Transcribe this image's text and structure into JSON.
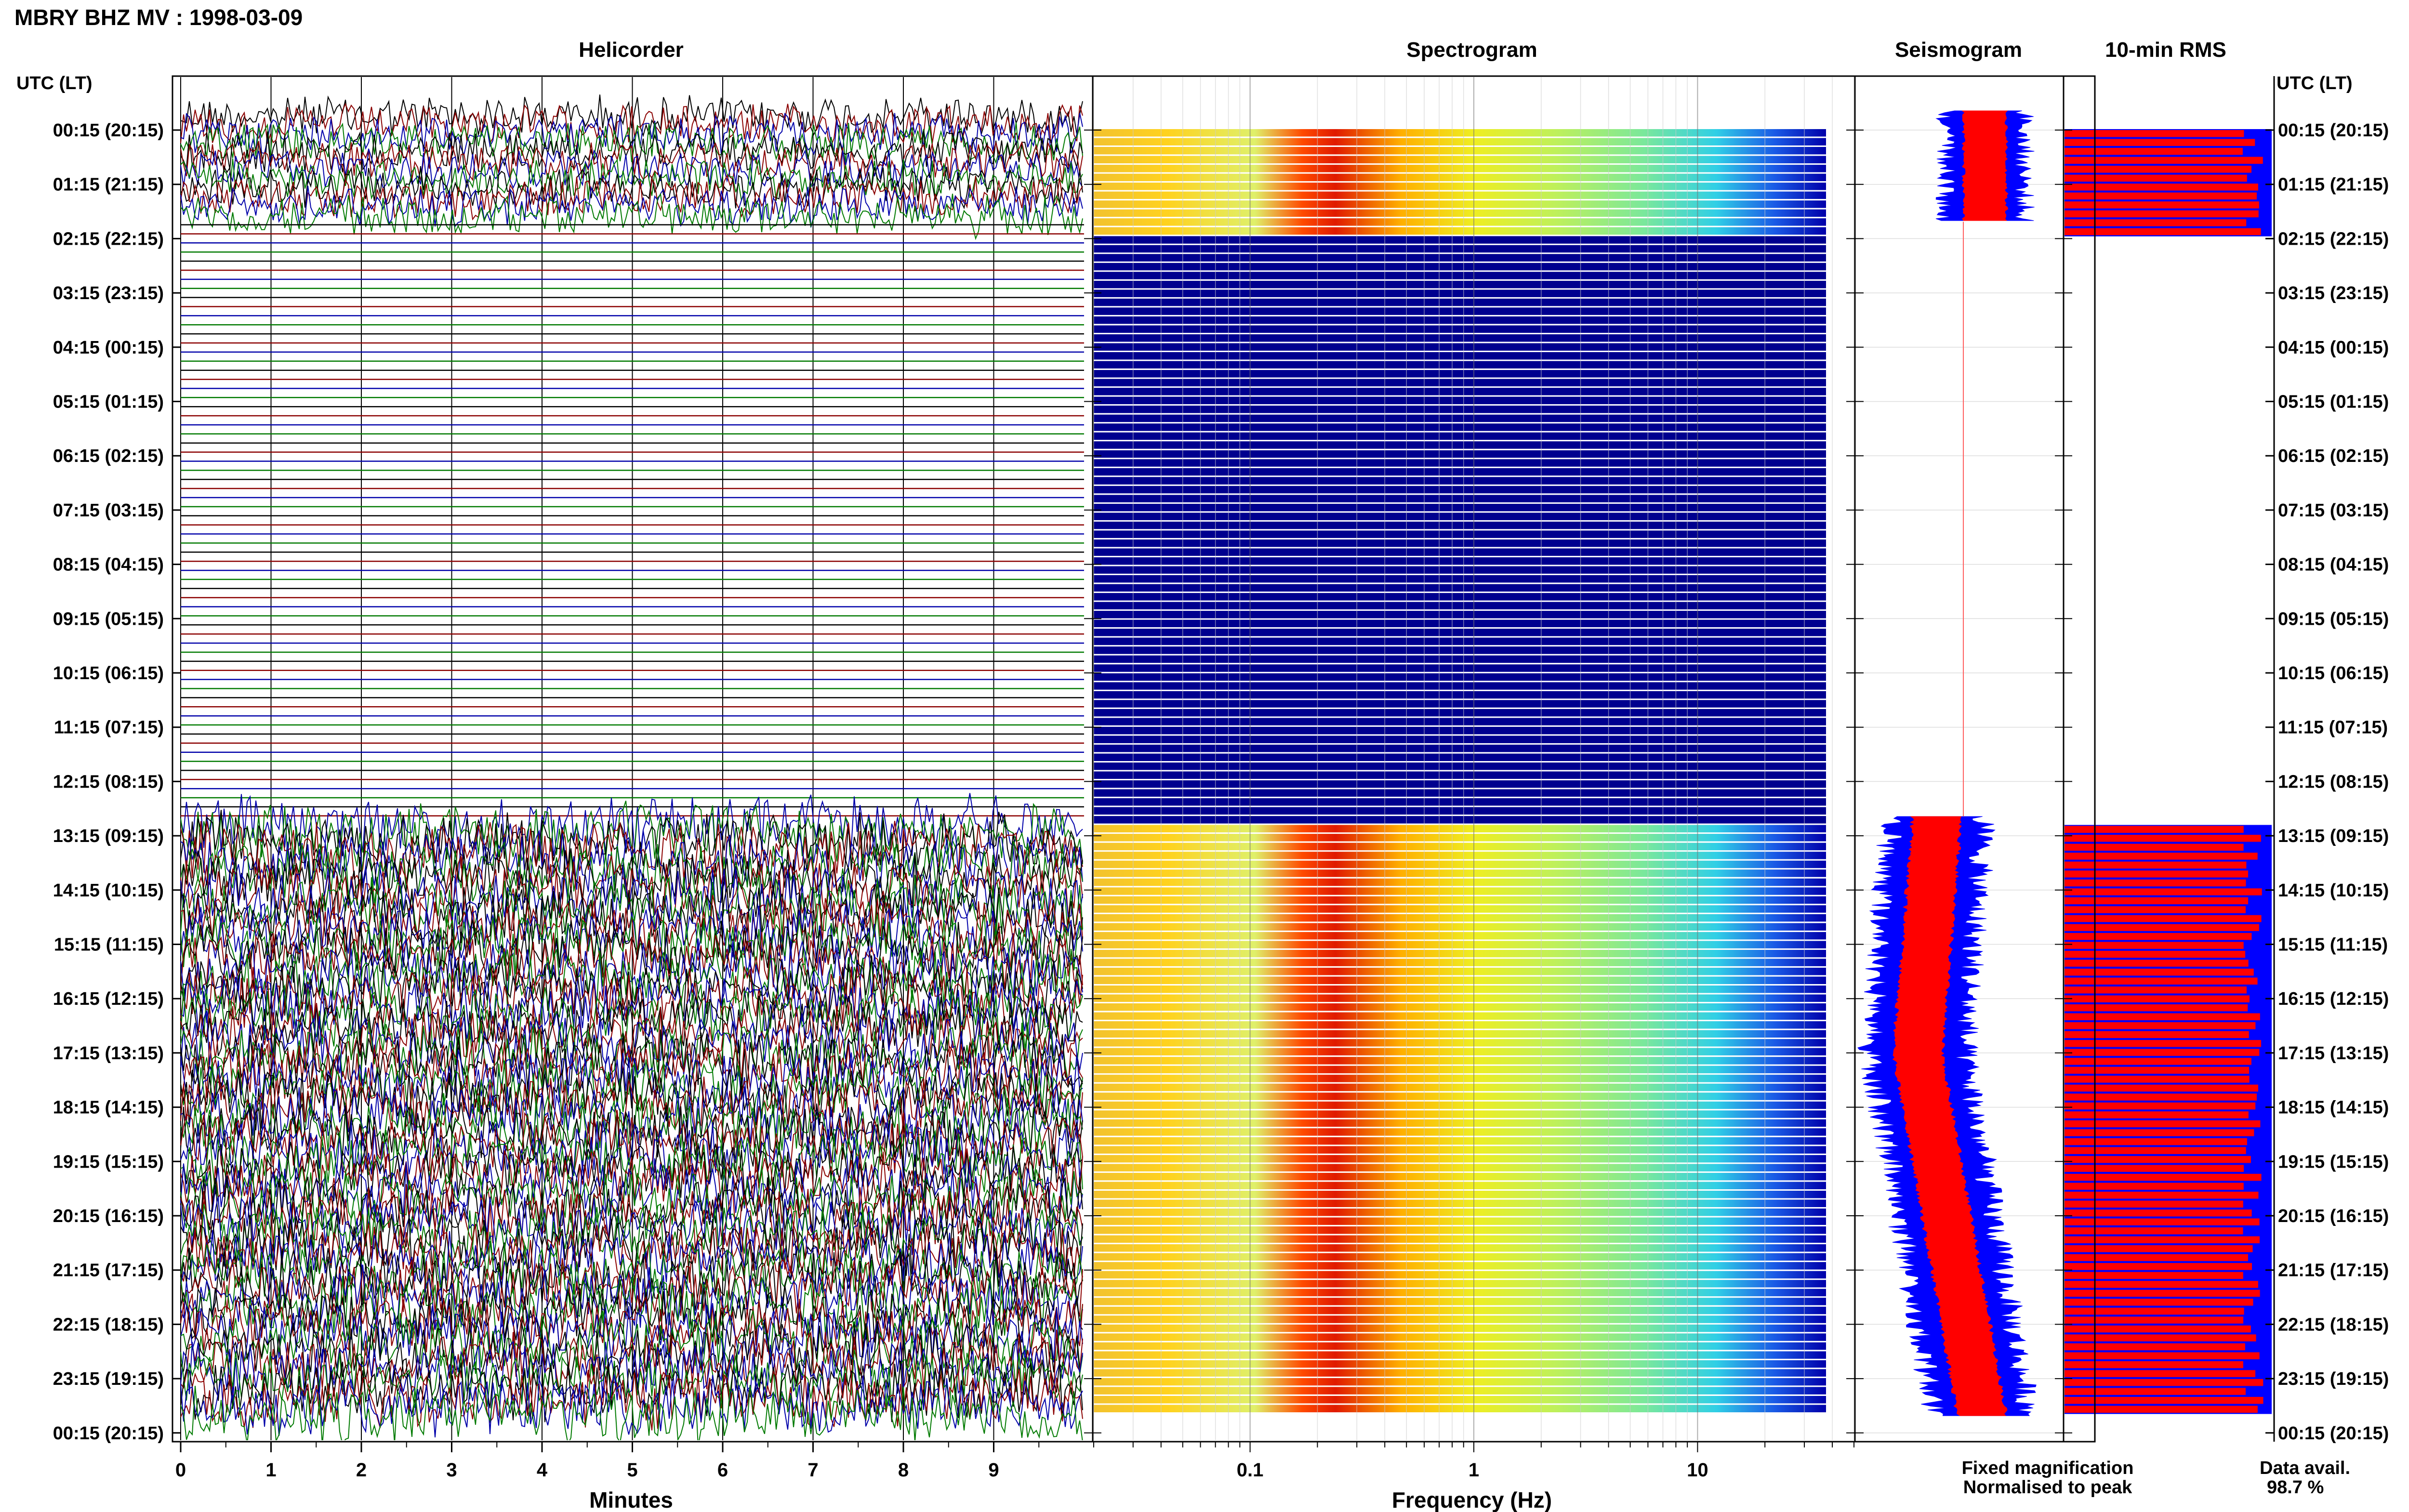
{
  "header": {
    "title": "MBRY BHZ MV : 1998-03-09"
  },
  "panels": {
    "helicorder": "Helicorder",
    "spectrogram": "Spectrogram",
    "seismogram": "Seismogram",
    "rms": "10-min RMS"
  },
  "axis": {
    "left_label": "UTC (LT)",
    "right_label": "UTC (LT)",
    "minutes_label": "Minutes",
    "frequency_label": "Frequency (Hz)"
  },
  "legend": {
    "fixed": "Fixed magnification",
    "normalised": "Normalised to peak",
    "fixed_color": "#0000ff",
    "normalised_color": "#ff0000"
  },
  "availability": {
    "label": "Data avail.",
    "value": "98.7 %"
  },
  "chart_data": {
    "type": "line",
    "time_labels": [
      "00:15 (20:15)",
      "01:15 (21:15)",
      "02:15 (22:15)",
      "03:15 (23:15)",
      "04:15 (00:15)",
      "05:15 (01:15)",
      "06:15 (02:15)",
      "07:15 (03:15)",
      "08:15 (04:15)",
      "09:15 (05:15)",
      "10:15 (06:15)",
      "11:15 (07:15)",
      "12:15 (08:15)",
      "13:15 (09:15)",
      "14:15 (10:15)",
      "15:15 (11:15)",
      "16:15 (12:15)",
      "17:15 (13:15)",
      "18:15 (14:15)",
      "19:15 (15:15)",
      "20:15 (16:15)",
      "21:15 (17:15)",
      "22:15 (18:15)",
      "23:15 (19:15)",
      "00:15 (20:15)"
    ],
    "minutes_ticks": [
      "0",
      "1",
      "2",
      "3",
      "4",
      "5",
      "6",
      "7",
      "8",
      "9"
    ],
    "minutes_range": [
      0,
      10
    ],
    "frequency_ticks": [
      "0.1",
      "1",
      "10"
    ],
    "frequency_range": [
      0.02,
      50
    ],
    "frequency_scale": "log",
    "gap_hours_utc": [
      2,
      13
    ],
    "trace_colors": [
      "#000000",
      "#8b0000",
      "#0000aa",
      "#007a00"
    ],
    "data_availability_percent": 98.7
  }
}
